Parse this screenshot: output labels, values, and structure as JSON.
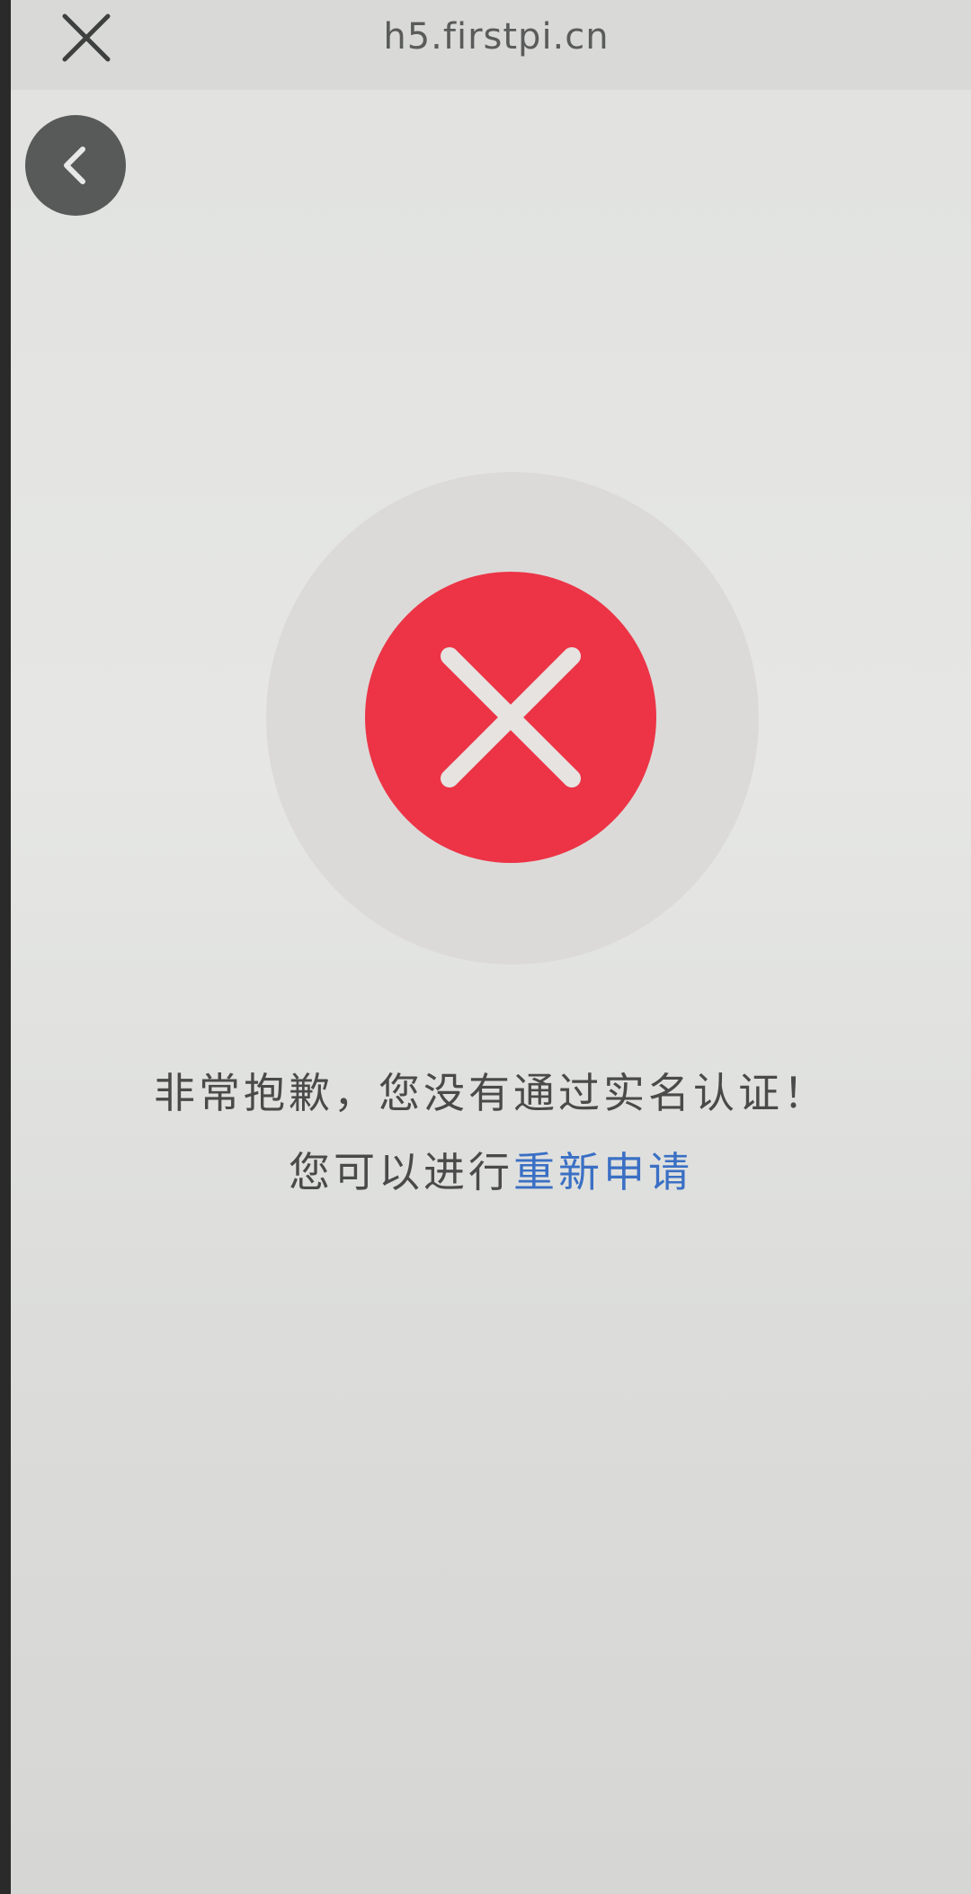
{
  "browser": {
    "url": "h5.firstpi.cn",
    "close_icon": "close-icon"
  },
  "nav": {
    "back_icon": "chevron-left-icon"
  },
  "result": {
    "status_icon": "x-circle-icon",
    "status_color": "#ec3446",
    "message": "非常抱歉，您没有通过实名认证！",
    "sub_prefix": "您可以进行",
    "reapply_label": "重新申请",
    "link_color": "#3a6fc4"
  }
}
